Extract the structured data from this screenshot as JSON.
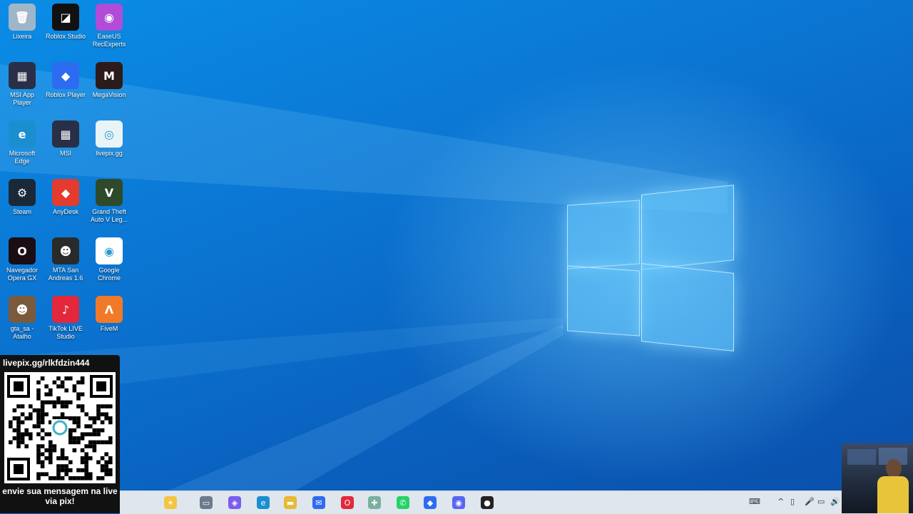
{
  "desktop": {
    "icons": [
      {
        "label": "Lixeira",
        "icon": "recycle-bin-icon",
        "color": "#9fb6c8",
        "glyph": "🗑"
      },
      {
        "label": "Roblox Studio",
        "icon": "roblox-studio-icon",
        "color": "#111111",
        "glyph": "◪"
      },
      {
        "label": "EaseUS RecExperts",
        "icon": "easeus-icon",
        "color": "#b04cd8",
        "glyph": "◉"
      },
      {
        "label": "MSI App Player",
        "icon": "msi-app-player-icon",
        "color": "#2a2f48",
        "glyph": "▦"
      },
      {
        "label": "Roblox Player",
        "icon": "roblox-player-icon",
        "color": "#2d6cf0",
        "glyph": "◆"
      },
      {
        "label": "MegaVision",
        "icon": "megavision-icon",
        "color": "#2b1b1b",
        "glyph": "M"
      },
      {
        "label": "Microsoft Edge",
        "icon": "edge-icon",
        "color": "#1a8fd0",
        "glyph": "e"
      },
      {
        "label": "MSI",
        "icon": "msi-icon",
        "color": "#2a2f48",
        "glyph": "▦"
      },
      {
        "label": "livepix.gg",
        "icon": "livepix-icon",
        "color": "#e8f4f6",
        "glyph": "◎"
      },
      {
        "label": "Steam",
        "icon": "steam-icon",
        "color": "#1b2838",
        "glyph": "⚙"
      },
      {
        "label": "AnyDesk",
        "icon": "anydesk-icon",
        "color": "#e33b2e",
        "glyph": "◆"
      },
      {
        "label": "Grand Theft Auto V Leg...",
        "icon": "gta-v-icon",
        "color": "#2f4a2a",
        "glyph": "V"
      },
      {
        "label": "Navegador Opera GX",
        "icon": "opera-gx-icon",
        "color": "#1a0d14",
        "glyph": "O"
      },
      {
        "label": "MTA San Andreas 1.6",
        "icon": "mta-icon",
        "color": "#2a2a2a",
        "glyph": "☻"
      },
      {
        "label": "Google Chrome",
        "icon": "chrome-icon",
        "color": "#ffffff",
        "glyph": "◉"
      },
      {
        "label": "gta_sa - Atalho",
        "icon": "gta-sa-icon",
        "color": "#7a5a3a",
        "glyph": "☻"
      },
      {
        "label": "TikTok LIVE Studio",
        "icon": "tiktok-live-icon",
        "color": "#e3283c",
        "glyph": "♪"
      },
      {
        "label": "FiveM",
        "icon": "fivem-icon",
        "color": "#f07a2a",
        "glyph": "Λ"
      }
    ]
  },
  "livepix": {
    "url": "livepix.gg/rlkfdzin444",
    "message": "envie sua mensagem na live via pix!"
  },
  "taskbar": {
    "items": [
      {
        "name": "copilot-icon",
        "glyph": "✦",
        "color": "#f5c542"
      },
      {
        "name": "task-view-icon",
        "glyph": "▭",
        "color": "#6b7a8c"
      },
      {
        "name": "copilot-app-icon",
        "glyph": "◈",
        "color": "#7b5cf0"
      },
      {
        "name": "edge-taskbar-icon",
        "glyph": "e",
        "color": "#1a8fd0"
      },
      {
        "name": "file-explorer-icon",
        "glyph": "▬",
        "color": "#e9b834"
      },
      {
        "name": "mail-icon",
        "glyph": "✉",
        "color": "#2d6cf0"
      },
      {
        "name": "opera-taskbar-icon",
        "glyph": "O",
        "color": "#e3283c"
      },
      {
        "name": "app-puzzle-icon",
        "glyph": "✚",
        "color": "#7ab0a0"
      },
      {
        "name": "whatsapp-icon",
        "glyph": "✆",
        "color": "#25d366"
      },
      {
        "name": "roblox-taskbar-icon",
        "glyph": "◆",
        "color": "#2d6cf0"
      },
      {
        "name": "discord-icon",
        "glyph": "◉",
        "color": "#5865f2"
      },
      {
        "name": "obs-icon",
        "glyph": "●",
        "color": "#222222"
      }
    ],
    "tray": [
      "⌨",
      "^",
      "▯",
      "🎤",
      "▭",
      "🔊"
    ]
  }
}
